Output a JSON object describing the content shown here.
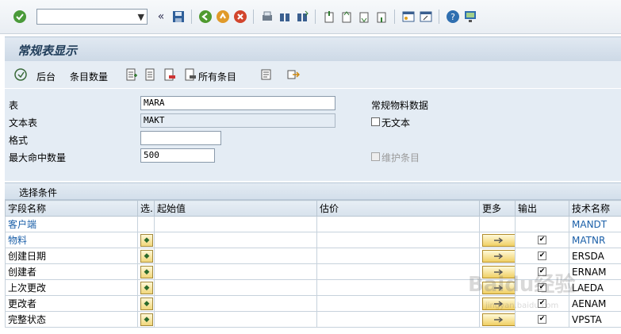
{
  "toolbar": {
    "command_field_value": "",
    "icons": [
      "enter-icon",
      "dropdown-icon",
      "back-arrows-icon",
      "save-icon",
      "back-icon",
      "exit-icon",
      "cancel-icon",
      "print-icon",
      "find-icon",
      "find-next-icon",
      "first-page-icon",
      "previous-page-icon",
      "next-page-icon",
      "last-page-icon",
      "create-session-icon",
      "shortcut-icon",
      "help-icon",
      "layout-icon"
    ]
  },
  "title": "常规表显示",
  "app_toolbar": {
    "background_label": "后台",
    "entries_count_label": "条目数量",
    "all_entries_label": "所有条目"
  },
  "form": {
    "table_label": "表",
    "table_value": "MARA",
    "table_desc": "常规物料数据",
    "text_table_label": "文本表",
    "text_table_value": "MAKT",
    "no_text_label": "无文本",
    "format_label": "格式",
    "format_value": "",
    "max_hits_label": "最大命中数量",
    "max_hits_value": "500",
    "maintain_entries_label": "维护条目"
  },
  "selection": {
    "section_title": "选择条件",
    "headers": {
      "field_name": "字段名称",
      "sel": "选.",
      "start_value": "起始值",
      "estimate": "估价",
      "more": "更多",
      "output": "输出",
      "tech_name": "技术名称"
    },
    "rows": [
      {
        "field": "客户端",
        "tech": "MANDT",
        "key": true,
        "has_sel": false,
        "has_more": false,
        "output": false
      },
      {
        "field": "物料",
        "tech": "MATNR",
        "key": true,
        "has_sel": true,
        "has_more": true,
        "output": true
      },
      {
        "field": "创建日期",
        "tech": "ERSDA",
        "key": false,
        "has_sel": true,
        "has_more": true,
        "output": true
      },
      {
        "field": "创建者",
        "tech": "ERNAM",
        "key": false,
        "has_sel": true,
        "has_more": true,
        "output": true
      },
      {
        "field": "上次更改",
        "tech": "LAEDA",
        "key": false,
        "has_sel": true,
        "has_more": true,
        "output": true
      },
      {
        "field": "更改者",
        "tech": "AENAM",
        "key": false,
        "has_sel": true,
        "has_more": true,
        "output": true
      },
      {
        "field": "完整状态",
        "tech": "VPSTA",
        "key": false,
        "has_sel": true,
        "has_more": true,
        "output": true
      }
    ]
  },
  "watermark": {
    "main": "Baidu经验",
    "sub": "jingyan.baidu.com"
  },
  "colors": {
    "key_field": "#1a5fa8",
    "title": "#1f3c59",
    "panel": "#e4ecf4"
  }
}
